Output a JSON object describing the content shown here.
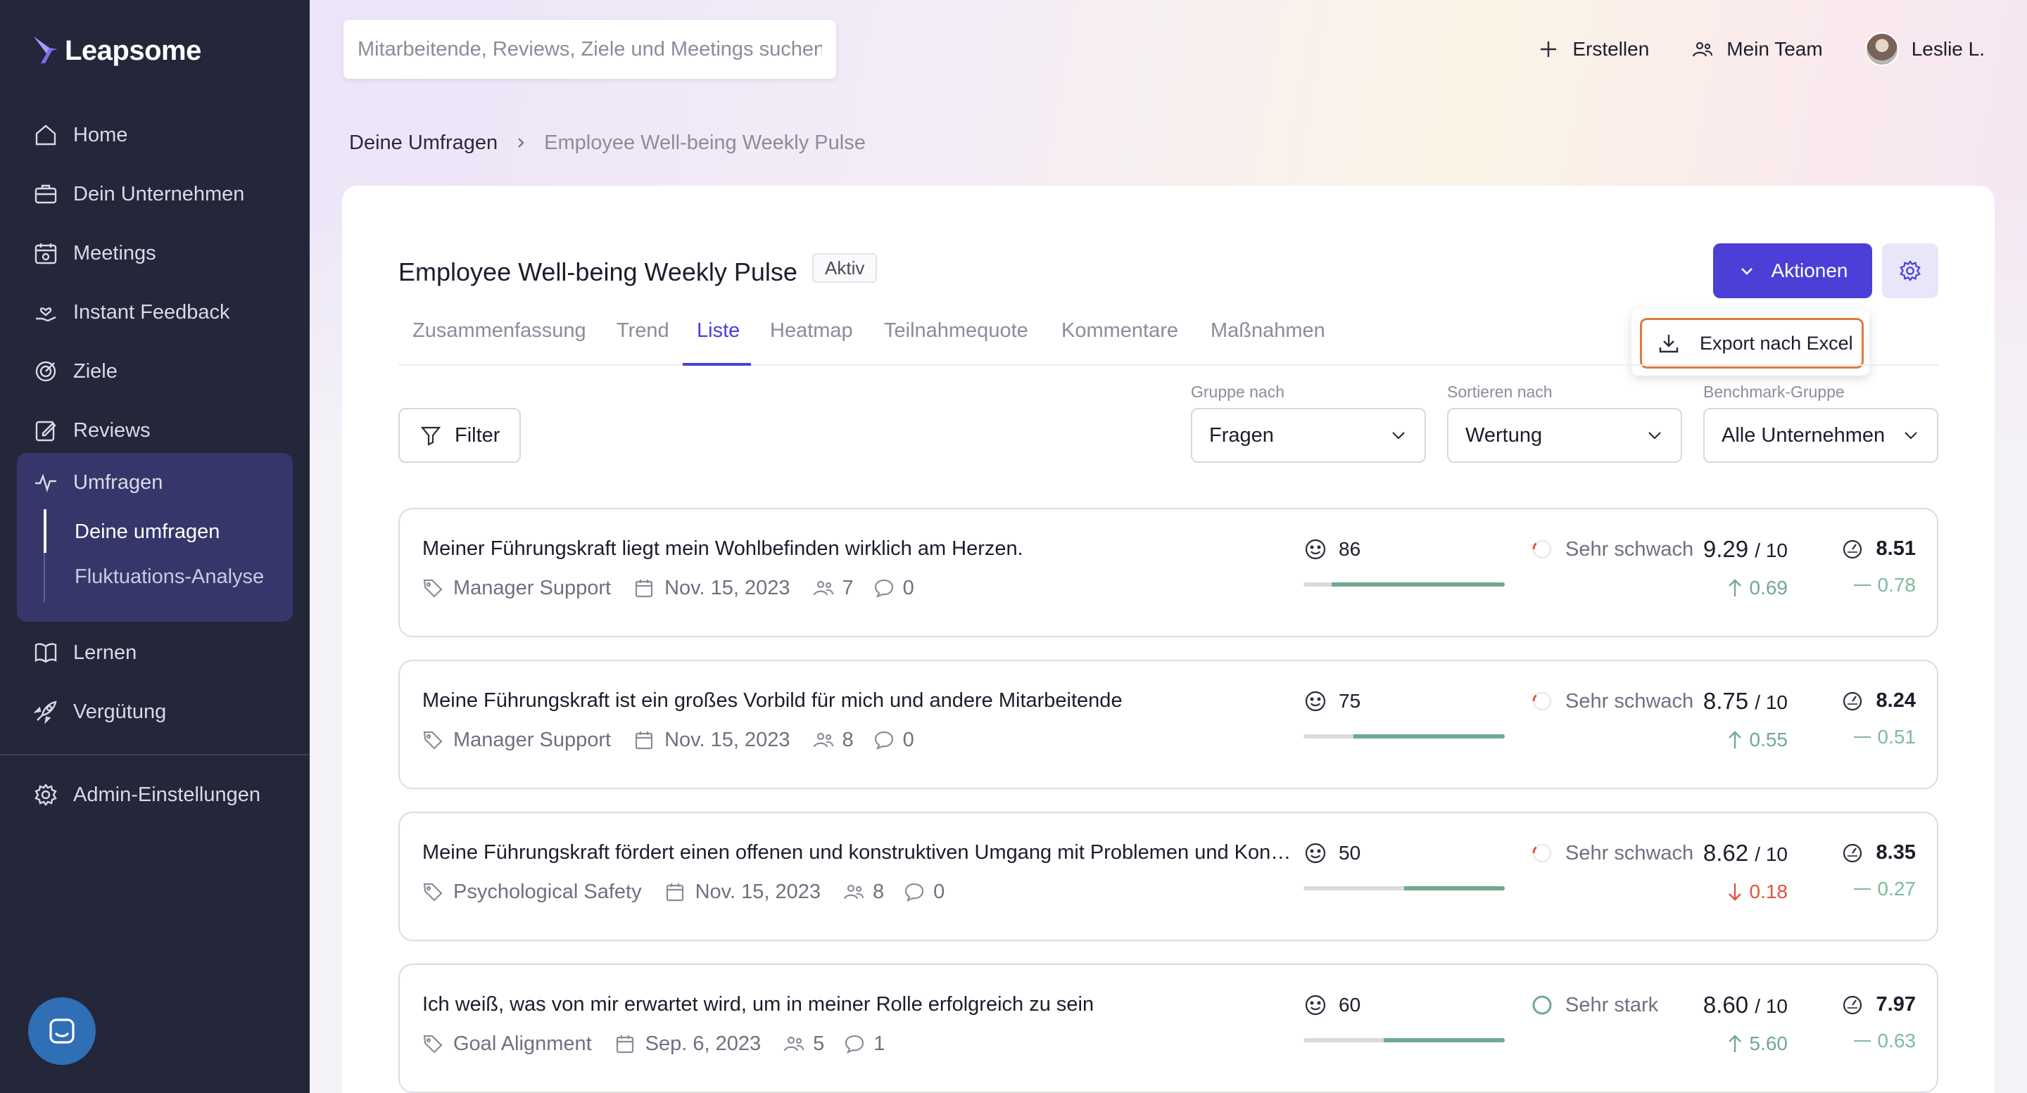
{
  "app": {
    "name": "Leapsome"
  },
  "colors": {
    "sidebar_bg": "#24263a",
    "accent": "#4b3fd8",
    "positive": "#6faa8e",
    "negative": "#e0533c",
    "highlight_border": "#e07a3c"
  },
  "sidebar": {
    "items": [
      {
        "label": "Home",
        "icon": "home-icon"
      },
      {
        "label": "Dein Unternehmen",
        "icon": "briefcase-icon"
      },
      {
        "label": "Meetings",
        "icon": "calendar-meeting-icon"
      },
      {
        "label": "Instant Feedback",
        "icon": "hand-heart-icon"
      },
      {
        "label": "Ziele",
        "icon": "target-icon"
      },
      {
        "label": "Reviews",
        "icon": "edit-document-icon"
      },
      {
        "label": "Umfragen",
        "icon": "pulse-icon"
      },
      {
        "label": "Lernen",
        "icon": "book-icon"
      },
      {
        "label": "Vergütung",
        "icon": "rocket-icon"
      },
      {
        "label": "Admin-Einstellungen",
        "icon": "gear-icon"
      }
    ],
    "sub_items": [
      {
        "label": "Deine umfragen",
        "active": true
      },
      {
        "label": "Fluktuations-Analyse",
        "active": false
      }
    ]
  },
  "topbar": {
    "search_placeholder": "Mitarbeitende, Reviews, Ziele und Meetings suchen",
    "create_label": "Erstellen",
    "team_label": "Mein Team",
    "user_name": "Leslie L."
  },
  "breadcrumb": {
    "root": "Deine Umfragen",
    "current": "Employee Well-being Weekly Pulse"
  },
  "survey": {
    "title": "Employee Well-being Weekly Pulse",
    "status": "Aktiv",
    "actions_label": "Aktionen",
    "export_label": "Export nach Excel"
  },
  "tabs": [
    {
      "label": "Zusammenfassung",
      "active": false
    },
    {
      "label": "Trend",
      "active": false
    },
    {
      "label": "Liste",
      "active": true
    },
    {
      "label": "Heatmap",
      "active": false
    },
    {
      "label": "Teilnahmequote",
      "active": false
    },
    {
      "label": "Kommentare",
      "active": false
    },
    {
      "label": "Maßnahmen",
      "active": false
    }
  ],
  "filters": {
    "filter_label": "Filter",
    "group_by": {
      "label": "Gruppe nach",
      "value": "Fragen"
    },
    "sort_by": {
      "label": "Sortieren nach",
      "value": "Wertung"
    },
    "benchmark": {
      "label": "Benchmark-Gruppe",
      "value": "Alle Unternehmen"
    }
  },
  "questions": [
    {
      "title": "Meiner Führungskraft liegt mein Wohlbefinden wirklich am Herzen.",
      "category": "Manager Support",
      "date": "Nov. 15, 2023",
      "participants": "7",
      "comments": "0",
      "engagement": "86",
      "engagement_fill": 0.86,
      "strength": "Sehr schwach",
      "strength_type": "weak",
      "score": "9.29",
      "score_denom": "/ 10",
      "delta": "0.69",
      "delta_dir": "up",
      "benchmark": "8.51",
      "benchmark_delta": "0.78"
    },
    {
      "title": "Meine Führungskraft ist ein großes Vorbild für mich und andere Mitarbeitende",
      "category": "Manager Support",
      "date": "Nov. 15, 2023",
      "participants": "8",
      "comments": "0",
      "engagement": "75",
      "engagement_fill": 0.75,
      "strength": "Sehr schwach",
      "strength_type": "weak",
      "score": "8.75",
      "score_denom": "/ 10",
      "delta": "0.55",
      "delta_dir": "up",
      "benchmark": "8.24",
      "benchmark_delta": "0.51"
    },
    {
      "title": "Meine Führungskraft fördert einen offenen und konstruktiven Umgang mit Problemen und Konflikten",
      "category": "Psychological Safety",
      "date": "Nov. 15, 2023",
      "participants": "8",
      "comments": "0",
      "engagement": "50",
      "engagement_fill": 0.5,
      "strength": "Sehr schwach",
      "strength_type": "weak",
      "score": "8.62",
      "score_denom": "/ 10",
      "delta": "0.18",
      "delta_dir": "down",
      "benchmark": "8.35",
      "benchmark_delta": "0.27"
    },
    {
      "title": "Ich weiß, was von mir erwartet wird, um in meiner Rolle erfolgreich zu sein",
      "category": "Goal Alignment",
      "date": "Sep. 6, 2023",
      "participants": "5",
      "comments": "1",
      "engagement": "60",
      "engagement_fill": 0.6,
      "strength": "Sehr stark",
      "strength_type": "strong",
      "score": "8.60",
      "score_denom": "/ 10",
      "delta": "5.60",
      "delta_dir": "up",
      "benchmark": "7.97",
      "benchmark_delta": "0.63"
    }
  ]
}
